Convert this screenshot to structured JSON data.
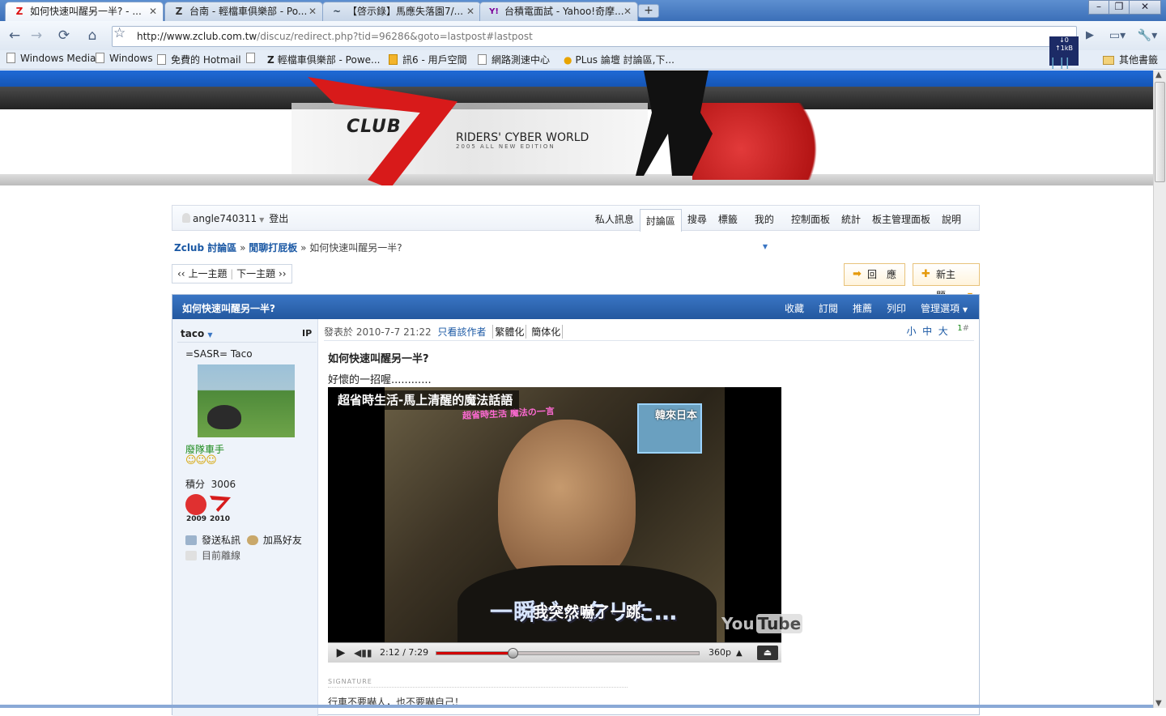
{
  "browser": {
    "tabs": [
      {
        "label": "如何快速叫醒另一半? - ...",
        "favicon": "Z"
      },
      {
        "label": "台南 - 輕檔車俱樂部 - Po...",
        "favicon": "Z"
      },
      {
        "label": "【啓示錄】馬應失落園7/...",
        "favicon": "~"
      },
      {
        "label": "台積電面試 - Yahoo!奇摩...",
        "favicon": "Y!"
      }
    ],
    "url_host": "http://www.zclub.com.tw",
    "url_path": "/discuz/redirect.php?tid=96286&goto=lastpost#lastpost",
    "netmon": "↓0 ↑1kB",
    "bookmarks": [
      "Windows Media",
      "Windows",
      "免費的 Hotmail",
      "",
      "輕檔車俱樂部 - Powe...",
      "訊6 - 用戶空間",
      "網路測速中心",
      "PLus 論壇 討論區,下...",
      "其他書籤"
    ]
  },
  "banner": {
    "logo_text": "CLUB",
    "slogan": "RIDERS' CYBER WORLD",
    "slogan_sub": "2005 ALL NEW EDITION"
  },
  "userbar": {
    "username": "angle740311",
    "logout": "登出",
    "menu": [
      "私人訊息",
      "討論區",
      "搜尋",
      "標籤",
      "我的",
      "控制面板",
      "統計",
      "板主管理面板",
      "說明"
    ]
  },
  "breadcrumb": {
    "root": "Zclub 討論區",
    "forum": "閒聊打屁板",
    "current": "如何快速叫醒另一半?"
  },
  "pager": {
    "prev": "上一主題",
    "next": "下一主題"
  },
  "actions": {
    "reply": "回　應",
    "new_topic": "新主題"
  },
  "thread": {
    "title": "如何快速叫醒另一半?",
    "tools": [
      "收藏",
      "訂閱",
      "推薦",
      "列印",
      "管理選項"
    ]
  },
  "author": {
    "name": "taco",
    "ip_label": "IP",
    "nick": "=SASR= Taco",
    "rank": "廢隊車手",
    "score_label": "積分",
    "score": "3006",
    "medal_years": [
      "2009",
      "2010"
    ],
    "send_pm": "發送私訊",
    "add_friend": "加爲好友",
    "status": "目前離線"
  },
  "post": {
    "meta_prefix": "發表於 2010-7-7 21:22",
    "only_author": "只看該作者",
    "trad": "繁體化",
    "simp": "簡体化",
    "font_sizes": [
      "小",
      "中",
      "大"
    ],
    "floor": "1",
    "floor_mark": "#",
    "title": "如何快速叫醒另一半?",
    "body": "好懷的一招喔............",
    "signature_label": "SIGNATURE",
    "signature": "行車不要嚇人，也不要嚇自己！"
  },
  "video": {
    "title": "超省時生活-馬上清醒的魔法話語",
    "subtitle_jp": "一瞬ビックリた…",
    "subtitle_cn": "我突然嚇了一跳",
    "pink_caption": "超省時生活 魔法の一言",
    "inset": "韓來日本",
    "logo_you": "You",
    "logo_tube": "Tube",
    "time": "2:12 / 7:29",
    "progress": 0.2941,
    "quality": "360p"
  }
}
